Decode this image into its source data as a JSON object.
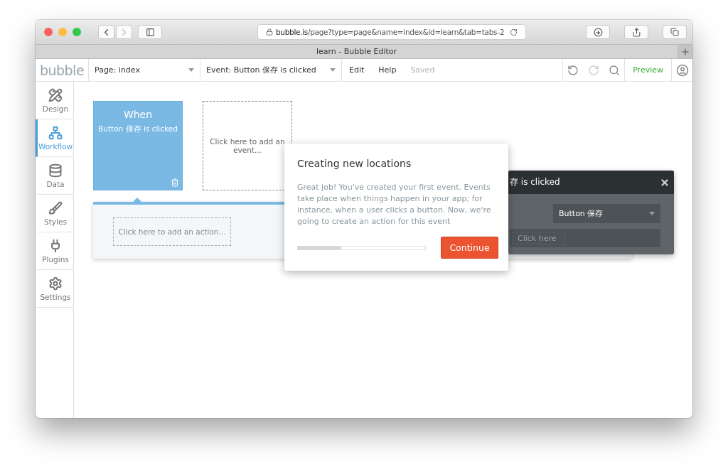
{
  "browser": {
    "url_host": "bubble.is",
    "url_path": "/page?type=page&name=index&id=learn&tab=tabs-2",
    "tab_title": "learn - Bubble Editor"
  },
  "toolbar": {
    "logo": "bubble",
    "page_dropdown": "Page: index",
    "event_dropdown": "Event: Button 保存 is clicked",
    "menu": [
      {
        "label": "Edit",
        "disabled": false
      },
      {
        "label": "Help",
        "disabled": false
      },
      {
        "label": "Saved",
        "disabled": true
      }
    ],
    "preview": "Preview"
  },
  "sidebar": {
    "items": [
      {
        "kind": "design",
        "label": "Design",
        "selected": false
      },
      {
        "kind": "workflow",
        "label": "Workflow",
        "selected": true
      },
      {
        "kind": "data",
        "label": "Data",
        "selected": false
      },
      {
        "kind": "styles",
        "label": "Styles",
        "selected": false
      },
      {
        "kind": "plugins",
        "label": "Plugins",
        "selected": false
      },
      {
        "kind": "settings",
        "label": "Settings",
        "selected": false
      }
    ]
  },
  "event_card": {
    "title": "When",
    "subtitle": "Button 保存 is clicked"
  },
  "add_event": "Click here to add an event...",
  "add_action": "Click here to add an action...",
  "property_panel": {
    "title": "存 is clicked",
    "element_dropdown": "Button 保存",
    "condition_field": {
      "placeholder": "Click here"
    }
  },
  "dialog": {
    "title": "Creating new locations",
    "body": "Great job! You've created your first event. Events take place when things happen in your app; for instance, when a user clicks a button. Now, we're going to create an action for this event",
    "progress": {
      "level": 0.34
    },
    "button": "Continue"
  }
}
